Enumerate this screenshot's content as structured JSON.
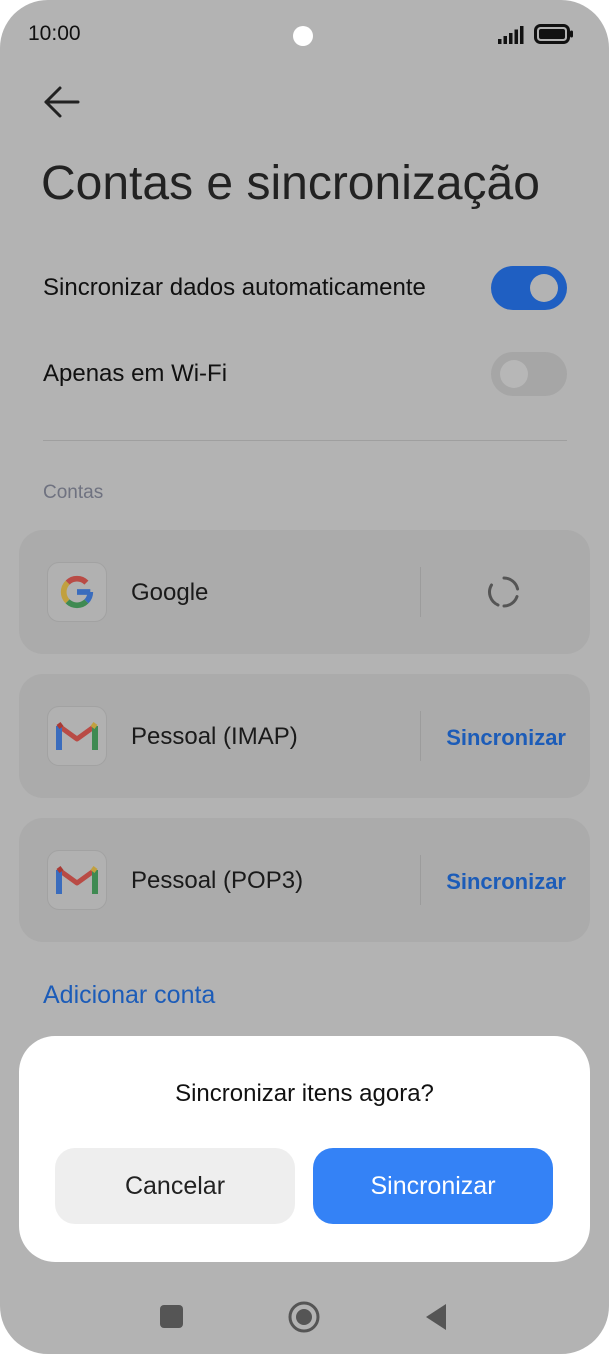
{
  "status_bar": {
    "time": "10:00"
  },
  "header": {
    "title": "Contas e sincronização"
  },
  "settings": [
    {
      "label": "Sincronizar dados automaticamente",
      "enabled": true
    },
    {
      "label": "Apenas em Wi-Fi",
      "enabled": false
    }
  ],
  "accounts_section": {
    "label": "Contas"
  },
  "accounts": [
    {
      "name": "Google",
      "icon": "google-icon",
      "action": "",
      "status": "syncing"
    },
    {
      "name": "Pessoal (IMAP)",
      "icon": "gmail-icon",
      "action": "Sincronizar"
    },
    {
      "name": "Pessoal (POP3)",
      "icon": "gmail-icon",
      "action": "Sincronizar"
    }
  ],
  "add_account": {
    "label": "Adicionar conta"
  },
  "dialog": {
    "title": "Sincronizar itens agora?",
    "cancel_label": "Cancelar",
    "confirm_label": "Sincronizar"
  },
  "colors": {
    "accent": "#3482f6",
    "link": "#1c5cb8",
    "toggle_on": "#1f5fc2",
    "scrim_background": "#b3b3b3"
  }
}
